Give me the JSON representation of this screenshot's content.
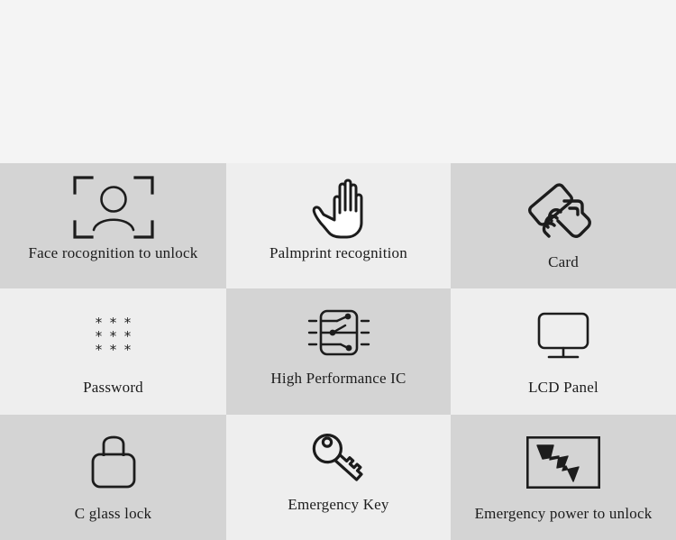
{
  "page": {
    "background_color": "#f4f4f4",
    "cell_shade_dark": "#d4d4d4",
    "cell_shade_light": "#eeeeee",
    "icon_stroke_color": "#1c1c1c"
  },
  "hero": {
    "text": ""
  },
  "features": [
    {
      "label": "Face rocognition to unlock",
      "icon": "face-recognition-icon",
      "shade": "dark",
      "label_low": false
    },
    {
      "label": "Palmprint recognition",
      "icon": "palm-hand-icon",
      "shade": "light",
      "label_low": false
    },
    {
      "label": "Card",
      "icon": "hand-holding-card-icon",
      "shade": "dark",
      "label_low": true
    },
    {
      "label": "Password",
      "icon": "asterisk-keypad-icon",
      "shade": "light",
      "label_low": true
    },
    {
      "label": "High Performance IC",
      "icon": "ic-chip-icon",
      "shade": "dark",
      "label_low": false
    },
    {
      "label": "LCD Panel",
      "icon": "monitor-icon",
      "shade": "light",
      "label_low": true
    },
    {
      "label": "C glass lock",
      "icon": "padlock-icon",
      "shade": "dark",
      "label_low": true
    },
    {
      "label": "Emergency Key",
      "icon": "key-icon",
      "shade": "light",
      "label_low": false
    },
    {
      "label": "Emergency power to unlock",
      "icon": "lightning-bolt-framed-icon",
      "shade": "dark",
      "label_low": true
    }
  ],
  "password_icon": {
    "symbols": [
      "*",
      "*",
      "*",
      "*",
      "*",
      "*",
      "*",
      "*",
      "*"
    ]
  }
}
